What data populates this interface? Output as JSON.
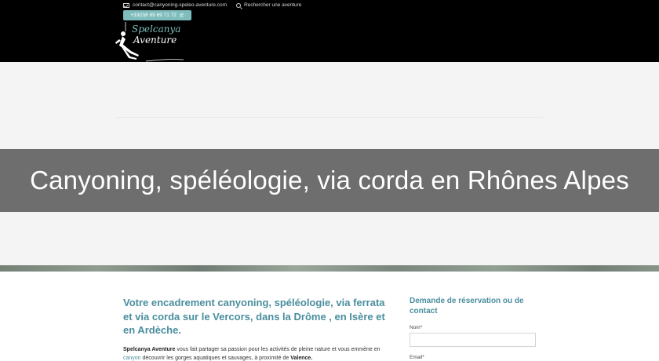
{
  "header": {
    "email": "contact@canyoning-speleo-aventure.com",
    "search_label": "Rechercher une aventure",
    "phone": "+33(0)6 89 69 71 72",
    "logo_line1": "Spelcanya",
    "logo_line2": "Aventure"
  },
  "banner": {
    "title": "Canyoning, spéléologie, via corda en Rhônes Alpes"
  },
  "main": {
    "heading": "Votre encadrement canyoning, spéléologie, via ferrata et via corda sur le Vercors, dans la Drôme , en Isère et en Ardèche.",
    "intro_brand": "Spelcanya Aventure",
    "intro_text_1": " vous fait partager sa passion pour les activités de pleine nature et vous emmène en ",
    "intro_link": "canyon",
    "intro_text_2": " découvrir les gorges aquatiques et sauvages, à proximité de ",
    "intro_city": "Valence."
  },
  "booking": {
    "title": "Demande de réservation ou de contact",
    "name_label": "Nom*",
    "email_label": "Email*"
  },
  "colors": {
    "accent": "#4a8e9e",
    "phone_button": "#7fbcbc",
    "band": "#6e6e6e"
  }
}
